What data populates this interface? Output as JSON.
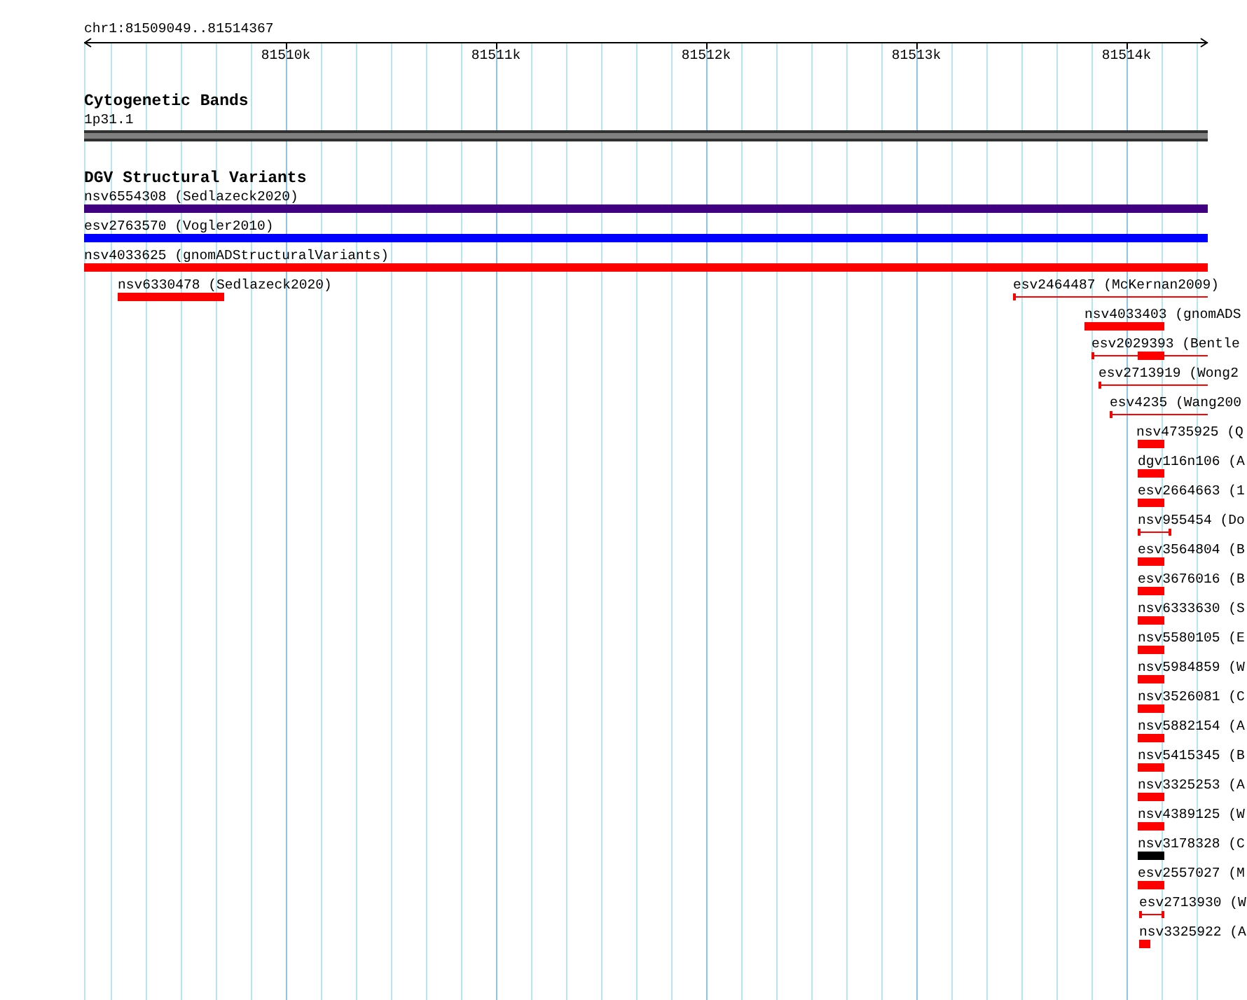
{
  "ruler": {
    "location": "chr1:81509049..81514367",
    "ticks": [
      "81510k",
      "81511k",
      "81512k",
      "81513k",
      "81514k"
    ]
  },
  "tracks": [
    {
      "kind": "bands",
      "title": "Cytogenetic Bands",
      "features": [
        {
          "label": "1p31.1"
        }
      ]
    },
    {
      "kind": "variants",
      "title": "DGV Structural Variants",
      "features": [
        {
          "label": "nsv6554308 (Sedlazeck2020)",
          "kind": "bar",
          "color": "#400080"
        },
        {
          "label": "esv2763570 (Vogler2010)",
          "kind": "bar",
          "color": "#0000ff"
        },
        {
          "label": "nsv4033625 (gnomADStructuralVariants)",
          "kind": "bar",
          "color": "#ff0000"
        },
        {
          "label": "nsv6330478 (Sedlazeck2020)",
          "kind": "bar",
          "color": "#ff0000"
        },
        {
          "label": "esv2464487 (McKernan2009)",
          "kind": "line",
          "color": "#ff0000"
        },
        {
          "label": "nsv4033403 (gnomADS",
          "kind": "bar",
          "color": "#ff0000"
        },
        {
          "label": "esv2029393 (Bentle",
          "kind": "split",
          "color": "#ff0000"
        },
        {
          "label": "esv2713919 (Wong2",
          "kind": "line",
          "color": "#ff0000"
        },
        {
          "label": "esv4235 (Wang200",
          "kind": "line",
          "color": "#ff0000"
        },
        {
          "label": "nsv4735925 (Q",
          "kind": "bar",
          "color": "#ff0000"
        },
        {
          "label": "dgv116n106 (A",
          "kind": "bar",
          "color": "#ff0000"
        },
        {
          "label": "esv2664663 (1",
          "kind": "bar",
          "color": "#ff0000"
        },
        {
          "label": "nsv955454 (Do",
          "kind": "capped",
          "color": "#ff0000"
        },
        {
          "label": "esv3564804 (B",
          "kind": "bar",
          "color": "#ff0000"
        },
        {
          "label": "esv3676016 (B",
          "kind": "bar",
          "color": "#ff0000"
        },
        {
          "label": "nsv6333630 (S",
          "kind": "bar",
          "color": "#ff0000"
        },
        {
          "label": "nsv5580105 (E",
          "kind": "bar",
          "color": "#ff0000"
        },
        {
          "label": "nsv5984859 (W",
          "kind": "bar",
          "color": "#ff0000"
        },
        {
          "label": "nsv3526081 (C",
          "kind": "bar",
          "color": "#ff0000"
        },
        {
          "label": "nsv5882154 (A",
          "kind": "bar",
          "color": "#ff0000"
        },
        {
          "label": "nsv5415345 (B",
          "kind": "bar",
          "color": "#ff0000"
        },
        {
          "label": "nsv3325253 (A",
          "kind": "bar",
          "color": "#ff0000"
        },
        {
          "label": "nsv4389125 (W",
          "kind": "bar",
          "color": "#ff0000"
        },
        {
          "label": "nsv3178328 (C",
          "kind": "bar",
          "color": "#000000"
        },
        {
          "label": "esv2557027 (M",
          "kind": "bar",
          "color": "#ff0000"
        },
        {
          "label": "esv2713930 (W",
          "kind": "capped",
          "color": "#ff0000"
        },
        {
          "label": "nsv3325922 (A",
          "kind": "bar",
          "color": "#ff0000"
        }
      ]
    }
  ]
}
